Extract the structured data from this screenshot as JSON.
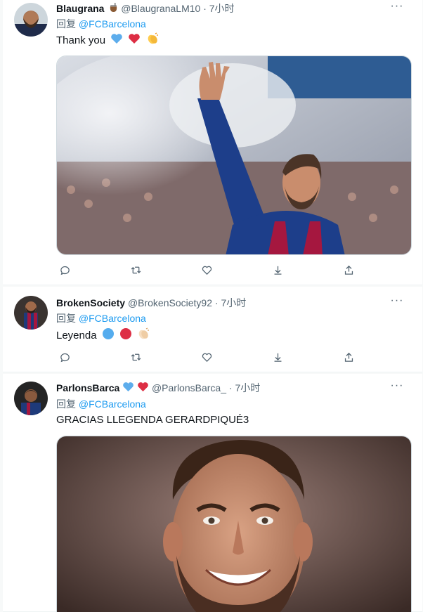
{
  "tweets": [
    {
      "name": "Blaugrana",
      "handle": "@BlaugranaLM10",
      "sep": "·",
      "time": "7小时",
      "reply_prefix": "回复",
      "reply_to": "@FCBarcelona",
      "text": "Thank you",
      "name_icons": [
        "mate-cup-icon"
      ],
      "text_icons": [
        "blue-heart-icon",
        "red-heart-icon",
        "clapping-hands-icon"
      ]
    },
    {
      "name": "BrokenSociety",
      "handle": "@BrokenSociety92",
      "sep": "·",
      "time": "7小时",
      "reply_prefix": "回复",
      "reply_to": "@FCBarcelona",
      "text": "Leyenda",
      "text_icons": [
        "blue-circle-icon",
        "red-circle-icon",
        "clapping-hands-icon"
      ]
    },
    {
      "name": "ParlonsBarca",
      "handle": "@ParlonsBarca_",
      "sep": "·",
      "time": "7小时",
      "reply_prefix": "回复",
      "reply_to": "@FCBarcelona",
      "text": "GRACIAS LLEGENDA GERARDPIQUÉ3",
      "name_icons": [
        "blue-heart-icon",
        "red-heart-icon"
      ]
    }
  ],
  "colors": {
    "accent": "#1d9bf0",
    "muted": "#536471",
    "text": "#0f1419",
    "page_bg": "#f7f9f9"
  },
  "action_icons": [
    "reply-icon",
    "retweet-icon",
    "like-icon",
    "download-icon",
    "share-icon"
  ],
  "more_label": "···"
}
